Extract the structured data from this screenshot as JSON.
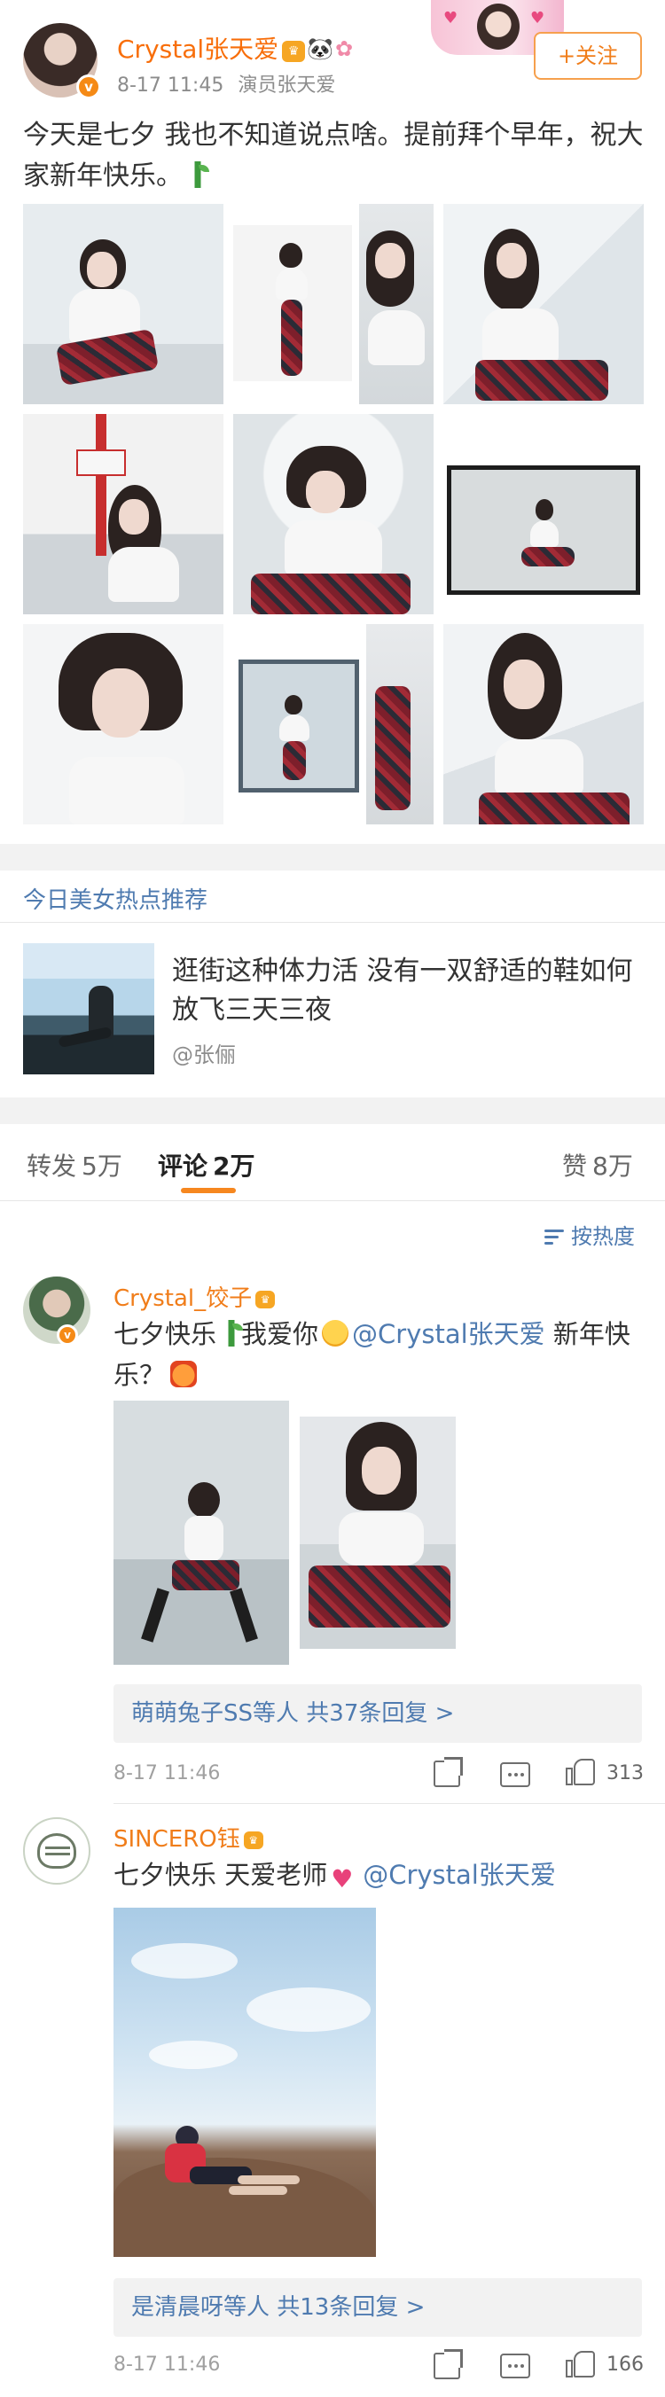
{
  "post": {
    "author": "Crystal张天爱",
    "time": "8-17 11:45",
    "source": "演员张天爱",
    "follow_label": "+关注",
    "text": "今天是七夕 我也不知道说点啥。提前拜个早年，祝大家新年快乐。",
    "image_count": 9
  },
  "recommendation": {
    "section_title": "今日美女热点推荐",
    "headline": "逛街这种体力活 没有一双舒适的鞋如何放飞三天三夜",
    "source": "@张俪"
  },
  "tabs": [
    {
      "label": "转发",
      "count": "5万"
    },
    {
      "label": "评论",
      "count": "2万"
    },
    {
      "label": "赞",
      "count": "8万"
    }
  ],
  "sort_label": "按热度",
  "comments": [
    {
      "user": "Crystal_饺子",
      "text_prefix": "七夕快乐",
      "text_mid": "我爱你",
      "mention": "@Crystal张天爱",
      "text_suffix": " 新年快乐？",
      "replies": "萌萌兔子SS等人  共37条回复 >",
      "time": "8-17 11:46",
      "likes": "313"
    },
    {
      "user": "SINCERO钰",
      "text_prefix": "七夕快乐 天爱老师",
      "mention": "@Crystal张天爱",
      "replies": "是清晨呀等人  共13条回复 >",
      "time": "8-17 11:46",
      "likes": "166"
    }
  ],
  "colors": {
    "accent_orange": "#f07d1a",
    "link_blue": "#4f7bb0",
    "divider": "#f2f2f2"
  }
}
